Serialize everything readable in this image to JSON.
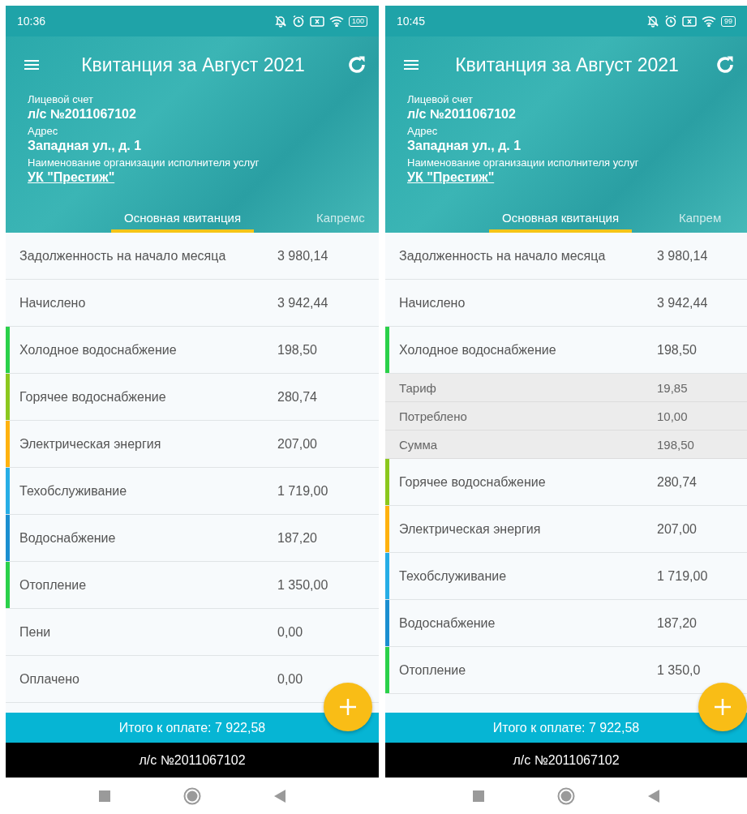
{
  "phones": [
    {
      "status_bar": {
        "time": "10:36",
        "battery": "100"
      },
      "title": "Квитанция за Август 2021",
      "account_label": "Лицевой счет",
      "account": "л/с №2011067102",
      "address_label": "Адрес",
      "address": "Западная ул., д. 1",
      "org_label": "Наименование организации исполнителя услуг",
      "org": "УК \"Престиж\"",
      "tabs": [
        {
          "label": "Основная квитанция",
          "selected": true
        },
        {
          "label": "Капремс",
          "selected": false
        }
      ],
      "rows": [
        {
          "kind": "plain",
          "label": "Задолженность на начало месяца",
          "value": "3 980,14"
        },
        {
          "kind": "plain",
          "label": "Начислено",
          "value": "3 942,44"
        },
        {
          "kind": "service",
          "label": "Холодное водоснабжение",
          "value": "198,50",
          "color": "#2bd14a"
        },
        {
          "kind": "service",
          "label": "Горячее водоснабжение",
          "value": "280,74",
          "color": "#8cc81e"
        },
        {
          "kind": "service",
          "label": "Электрическая энергия",
          "value": "207,00",
          "color": "#ffb20f"
        },
        {
          "kind": "service",
          "label": "Техобслуживание",
          "value": "1 719,00",
          "color": "#27aee6"
        },
        {
          "kind": "service",
          "label": "Водоснабжение",
          "value": "187,20",
          "color": "#1b8fd0"
        },
        {
          "kind": "service",
          "label": "Отопление",
          "value": "1 350,00",
          "color": "#2bd14a"
        },
        {
          "kind": "plain",
          "label": "Пени",
          "value": "0,00"
        },
        {
          "kind": "plain",
          "label": "Оплачено",
          "value": "0,00"
        }
      ],
      "total": "Итого к оплате: 7 922,58",
      "footer": "л/с №2011067102"
    },
    {
      "status_bar": {
        "time": "10:45",
        "battery": "99"
      },
      "title": "Квитанция за Август 2021",
      "account_label": "Лицевой счет",
      "account": "л/с №2011067102",
      "address_label": "Адрес",
      "address": "Западная ул., д. 1",
      "org_label": "Наименование организации исполнителя услуг",
      "org": "УК \"Престиж\"",
      "tabs": [
        {
          "label": "Основная квитанция",
          "selected": true
        },
        {
          "label": "Капрем",
          "selected": false
        }
      ],
      "rows": [
        {
          "kind": "plain",
          "label": "Задолженность на начало месяца",
          "value": "3 980,14"
        },
        {
          "kind": "plain",
          "label": "Начислено",
          "value": "3 942,44"
        },
        {
          "kind": "service",
          "label": "Холодное водоснабжение",
          "value": "198,50",
          "color": "#2bd14a",
          "expanded": true,
          "details": [
            {
              "label": "Тариф",
              "value": "19,85"
            },
            {
              "label": "Потреблено",
              "value": "10,00"
            },
            {
              "label": "Сумма",
              "value": "198,50"
            }
          ]
        },
        {
          "kind": "service",
          "label": "Горячее водоснабжение",
          "value": "280,74",
          "color": "#8cc81e"
        },
        {
          "kind": "service",
          "label": "Электрическая энергия",
          "value": "207,00",
          "color": "#ffb20f"
        },
        {
          "kind": "service",
          "label": "Техобслуживание",
          "value": "1 719,00",
          "color": "#27aee6"
        },
        {
          "kind": "service",
          "label": "Водоснабжение",
          "value": "187,20",
          "color": "#1b8fd0"
        },
        {
          "kind": "service",
          "label": "Отопление",
          "value": "1 350,0",
          "color": "#2bd14a"
        }
      ],
      "total": "Итого к оплате: 7 922,58",
      "footer": "л/с №2011067102"
    }
  ]
}
